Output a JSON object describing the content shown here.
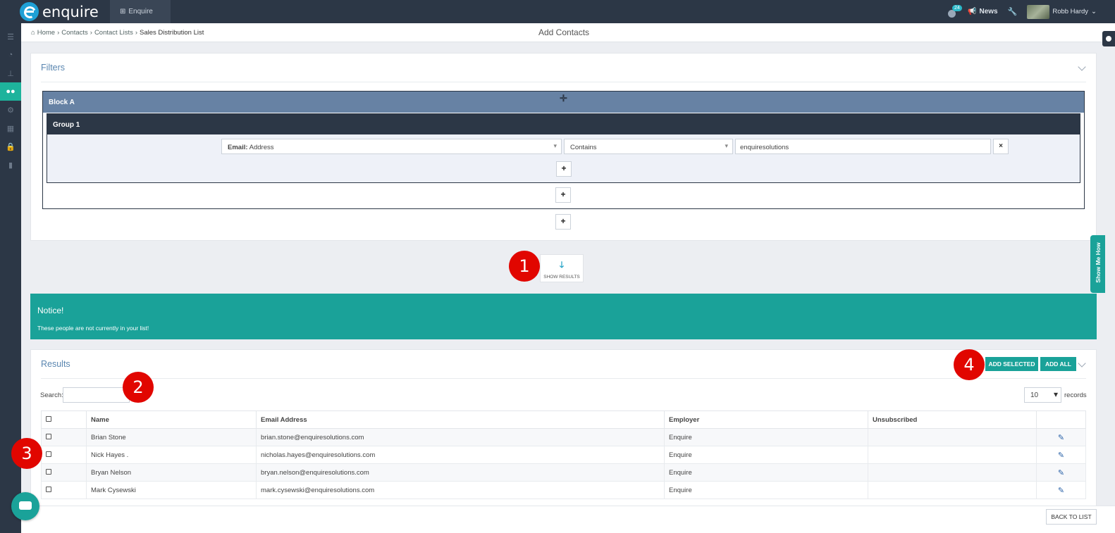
{
  "topbar": {
    "app_name": "enquire",
    "tab_label": "Enquire",
    "notification_count": "24",
    "news_label": "News",
    "user_name": "Robb Hardy"
  },
  "sidebar": {
    "items": [
      "menu-icon",
      "dashboard-icon",
      "sitemap-icon",
      "contacts-icon",
      "cogs-icon",
      "grid-icon",
      "lock-icon",
      "trash-icon"
    ],
    "active_index": 3
  },
  "breadcrumb": {
    "home": "Home",
    "items": [
      "Contacts",
      "Contact Lists"
    ],
    "current": "Sales Distribution List",
    "separator": "›"
  },
  "page_title": "Add Contacts",
  "filters": {
    "title": "Filters",
    "block_label": "Block A",
    "group_label": "Group 1",
    "field_prefix": "Email:",
    "field_value": "Address",
    "operator": "Contains",
    "value": "enquiresolutions",
    "remove_label": "×",
    "add_label": "+"
  },
  "show_results_label": "SHOW RESULTS",
  "notice": {
    "title": "Notice!",
    "text": "These people are not currently in your list!"
  },
  "results": {
    "title": "Results",
    "add_selected_label": "ADD SELECTED",
    "add_all_label": "ADD ALL",
    "search_label": "Search:",
    "records_value": "10",
    "records_label": "records",
    "columns": [
      "Name",
      "Email Address",
      "Employer",
      "Unsubscribed"
    ],
    "rows": [
      {
        "name": "Brian Stone",
        "email": "brian.stone@enquiresolutions.com",
        "employer": "Enquire",
        "unsubscribed": ""
      },
      {
        "name": "Nick Hayes .",
        "email": "nicholas.hayes@enquiresolutions.com",
        "employer": "Enquire",
        "unsubscribed": ""
      },
      {
        "name": "Bryan Nelson",
        "email": "bryan.nelson@enquiresolutions.com",
        "employer": "Enquire",
        "unsubscribed": ""
      },
      {
        "name": "Mark Cysewski",
        "email": "mark.cysewski@enquiresolutions.com",
        "employer": "Enquire",
        "unsubscribed": ""
      }
    ]
  },
  "callouts": [
    "1",
    "2",
    "3",
    "4"
  ],
  "back_button_label": "BACK TO LIST",
  "show_me_how_label": "Show Me How",
  "colors": {
    "topbar": "#2c3746",
    "accent_teal": "#1aa299",
    "block_header": "#6782a4",
    "callout_red": "#e10600",
    "panel_title": "#5a86b0"
  }
}
